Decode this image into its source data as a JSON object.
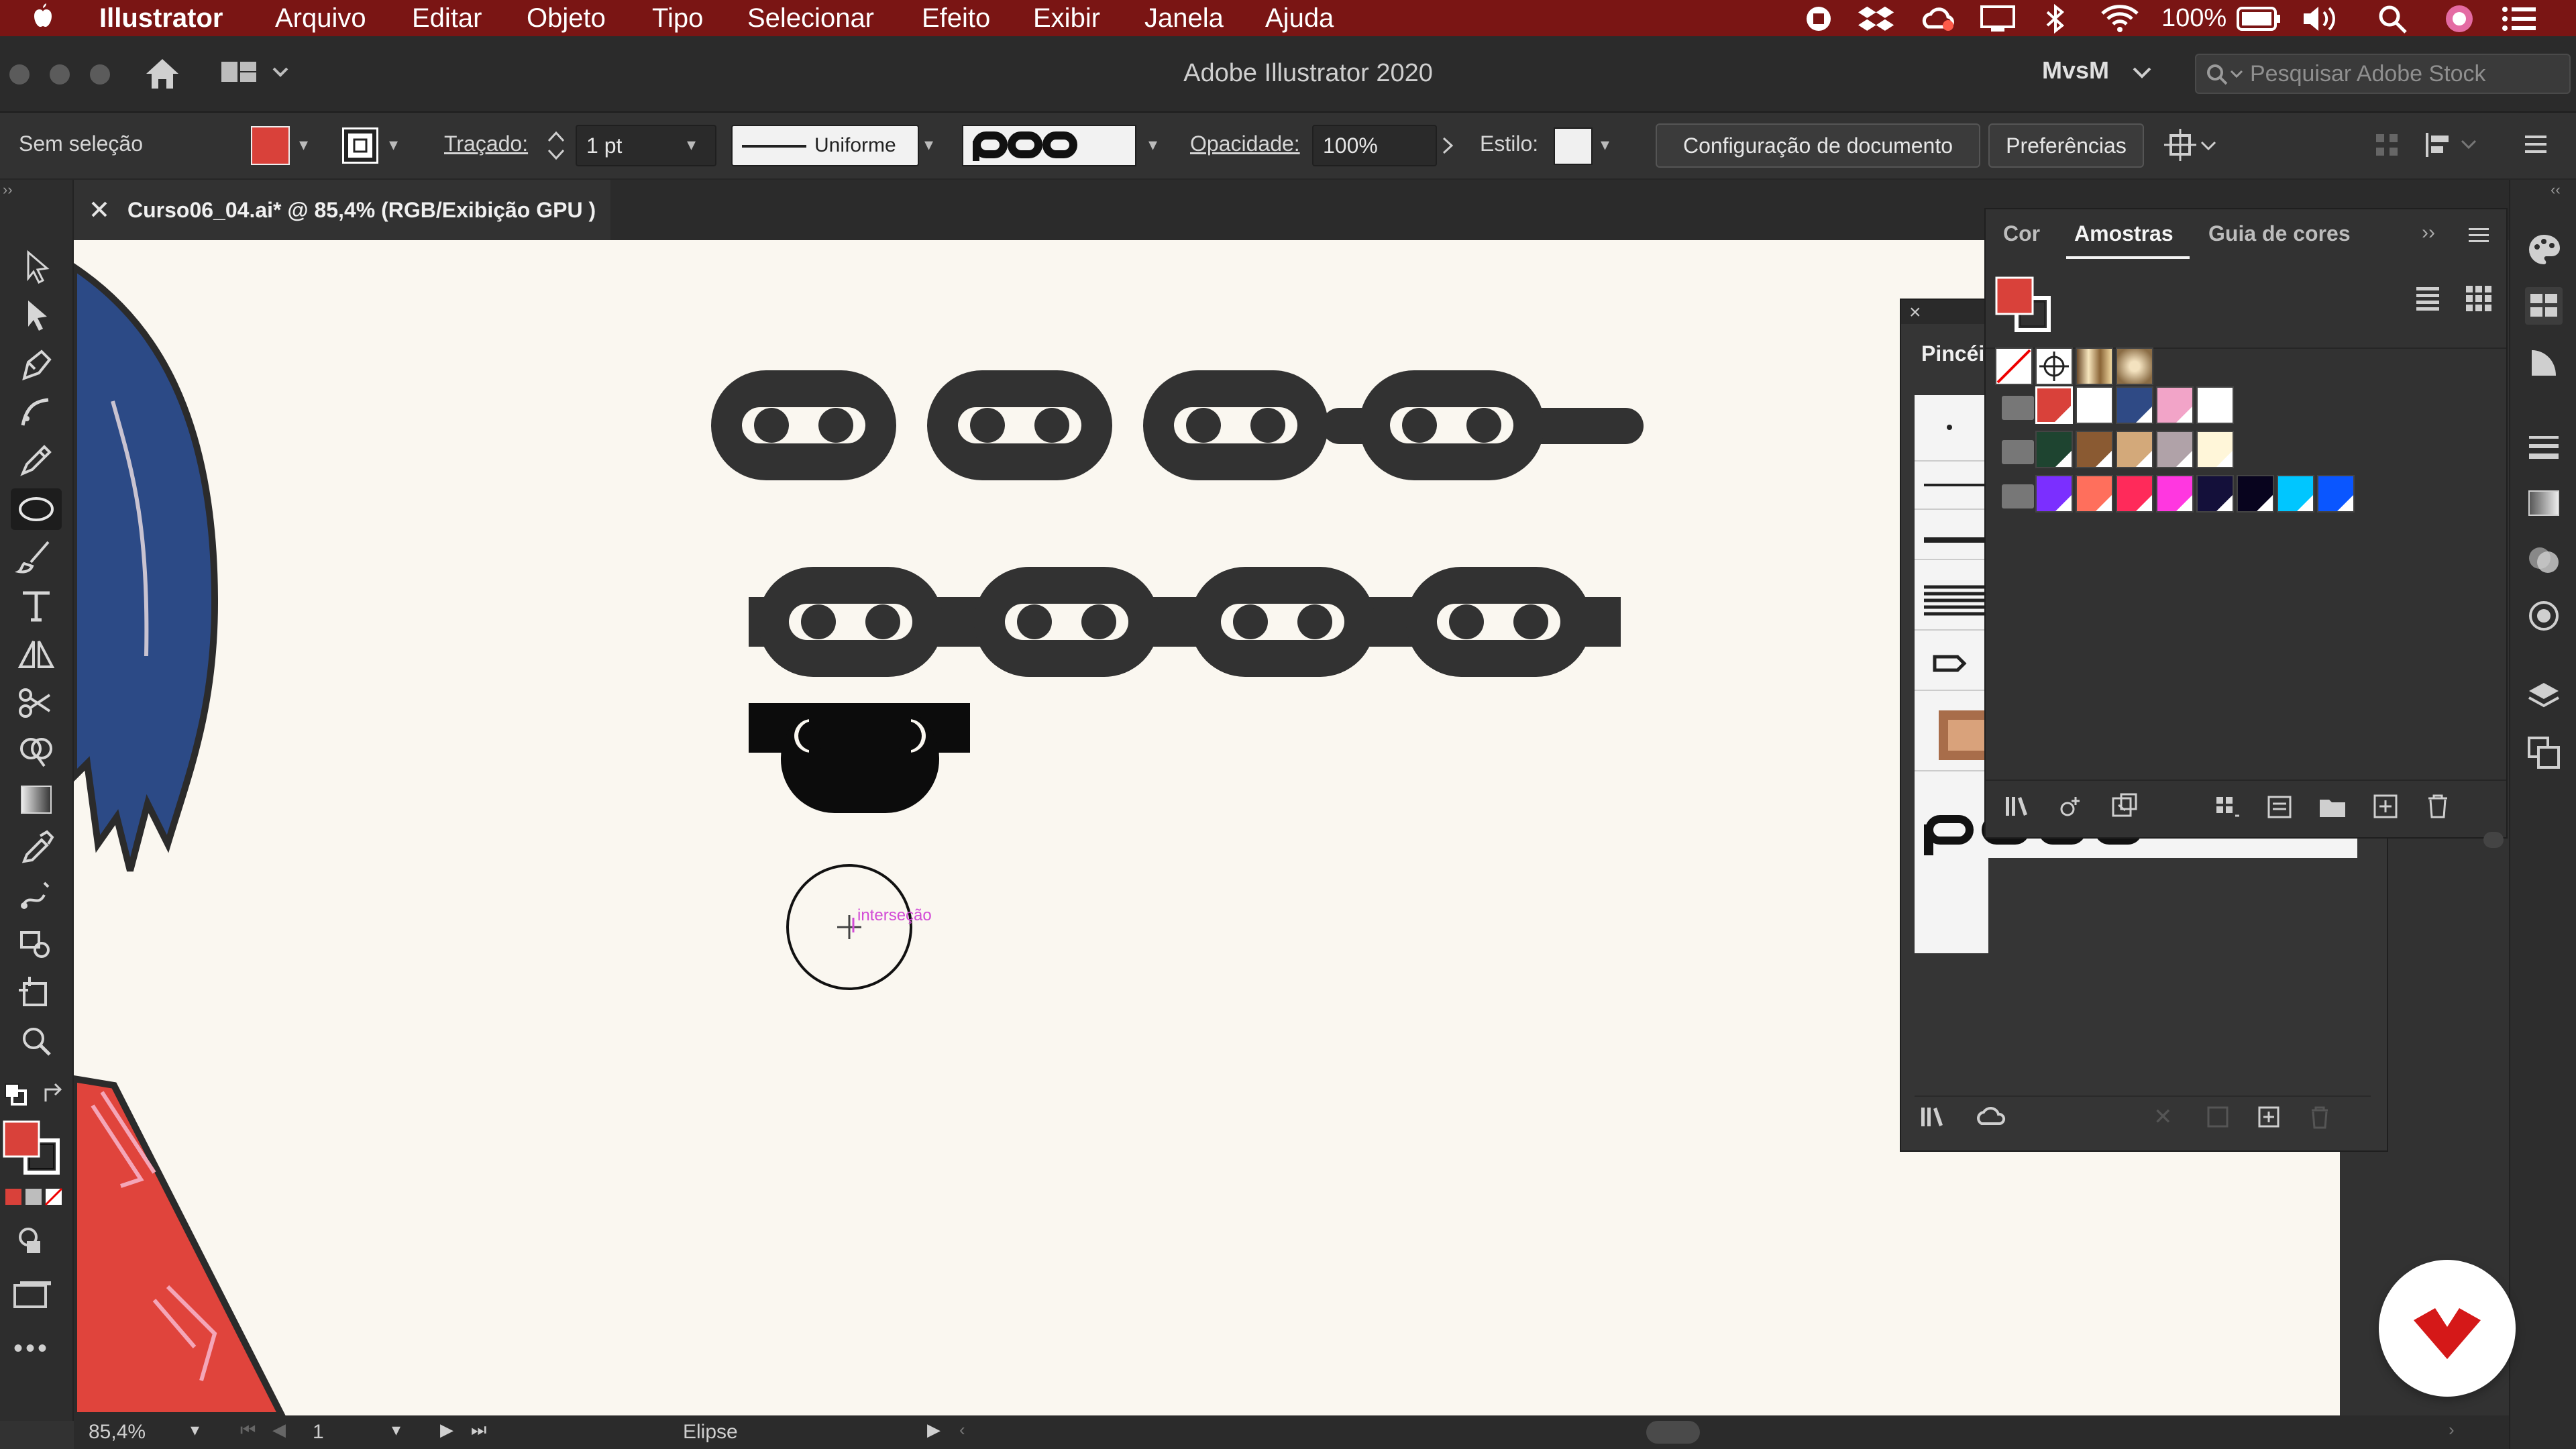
{
  "menubar": {
    "items": [
      "Illustrator",
      "Arquivo",
      "Editar",
      "Objeto",
      "Tipo",
      "Selecionar",
      "Efeito",
      "Exibir",
      "Janela",
      "Ajuda"
    ],
    "battery": "100%"
  },
  "titlebar": {
    "title": "Adobe Illustrator 2020",
    "workspace": "MvsM",
    "search_placeholder": "Pesquisar Adobe Stock"
  },
  "control": {
    "selection": "Sem seleção",
    "stroke_label": "Traçado:",
    "stroke_value": "1 pt",
    "profile": "Uniforme",
    "opacity_label": "Opacidade:",
    "opacity_value": "100%",
    "style_label": "Estilo:",
    "doc_setup": "Configuração de documento",
    "prefs": "Preferências",
    "fill_color": "#d9413a"
  },
  "document": {
    "tab": "Curso06_04.ai* @ 85,4% (RGB/Exibição GPU )"
  },
  "canvas": {
    "smart_guide": "interseção"
  },
  "status": {
    "zoom": "85,4%",
    "artboard": "1",
    "tool": "Elipse"
  },
  "brushes_panel": {
    "title": "Pincéi"
  },
  "swatches_panel": {
    "tabs": [
      "Cor",
      "Amostras",
      "Guia de cores"
    ],
    "active_tab": "Amostras",
    "row1": [
      "#ffffff",
      "#ffffff",
      "#c9a36a",
      "#b99064"
    ],
    "row2": [
      "#d9413a",
      "#ffffff",
      "#2f4a85",
      "#f2a4c8",
      "#ffffff"
    ],
    "row3": [
      "#1e4430",
      "#8a5a32",
      "#d3a97a",
      "#b0a2a8",
      "#fff6d9"
    ],
    "row4": [
      "#7b2fff",
      "#ff6f5c",
      "#ff2a5a",
      "#ff37e0",
      "#14103a",
      "#08041e",
      "#00c6ff",
      "#0a56ff"
    ]
  },
  "colors": {
    "menubar": "#7a1514",
    "canvas": "#faf7f0",
    "chain": "#323232",
    "accent_red": "#d9413a",
    "guide": "#d24bd6"
  }
}
